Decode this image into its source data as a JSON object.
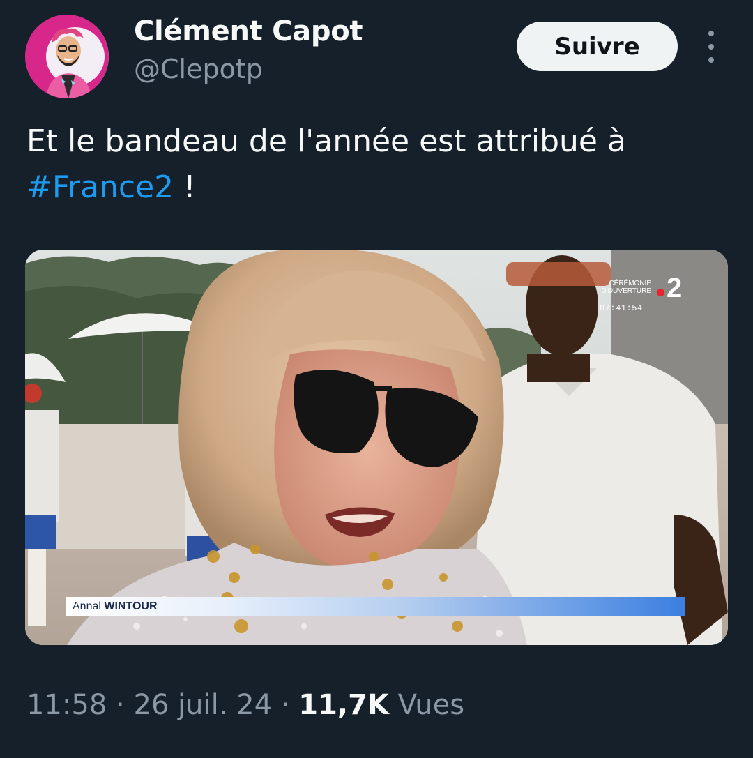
{
  "author": {
    "name": "Clément Capot",
    "handle": "@Clepotp"
  },
  "follow_label": "Suivre",
  "tweet": {
    "text_line1": "Et le bandeau de l'année est attribué à",
    "hashtag": "#France2",
    "text_end": " !"
  },
  "media": {
    "broadcast_label_line1": "CÉRÉMONIE",
    "broadcast_label_line2": "D'OUVERTURE",
    "channel_logo": "2",
    "timestamp": "07:41:54",
    "lower_third_first": "Annal",
    "lower_third_last": "WINTOUR"
  },
  "meta": {
    "time": "11:58",
    "separator": " · ",
    "date": "26 juil. 24",
    "views_count": "11,7K",
    "views_label": " Vues"
  },
  "colors": {
    "background": "#15202b",
    "text_primary": "#f7f9f9",
    "text_secondary": "#8b98a5",
    "link": "#1d9bf0",
    "follow_bg": "#eff3f4"
  },
  "icons": {
    "more": "more-vertical-icon"
  }
}
